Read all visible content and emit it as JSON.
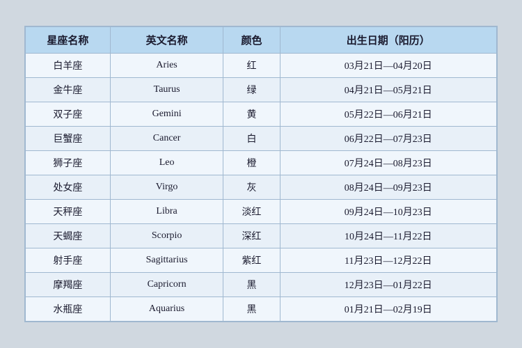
{
  "table": {
    "headers": [
      "星座名称",
      "英文名称",
      "颜色",
      "出生日期（阳历）"
    ],
    "rows": [
      {
        "zh": "白羊座",
        "en": "Aries",
        "color": "红",
        "date": "03月21日—04月20日"
      },
      {
        "zh": "金牛座",
        "en": "Taurus",
        "color": "绿",
        "date": "04月21日—05月21日"
      },
      {
        "zh": "双子座",
        "en": "Gemini",
        "color": "黄",
        "date": "05月22日—06月21日"
      },
      {
        "zh": "巨蟹座",
        "en": "Cancer",
        "color": "白",
        "date": "06月22日—07月23日"
      },
      {
        "zh": "狮子座",
        "en": "Leo",
        "color": "橙",
        "date": "07月24日—08月23日"
      },
      {
        "zh": "处女座",
        "en": "Virgo",
        "color": "灰",
        "date": "08月24日—09月23日"
      },
      {
        "zh": "天秤座",
        "en": "Libra",
        "color": "淡红",
        "date": "09月24日—10月23日"
      },
      {
        "zh": "天蝎座",
        "en": "Scorpio",
        "color": "深红",
        "date": "10月24日—11月22日"
      },
      {
        "zh": "射手座",
        "en": "Sagittarius",
        "color": "紫红",
        "date": "11月23日—12月22日"
      },
      {
        "zh": "摩羯座",
        "en": "Capricorn",
        "color": "黑",
        "date": "12月23日—01月22日"
      },
      {
        "zh": "水瓶座",
        "en": "Aquarius",
        "color": "黑",
        "date": "01月21日—02月19日"
      }
    ]
  }
}
